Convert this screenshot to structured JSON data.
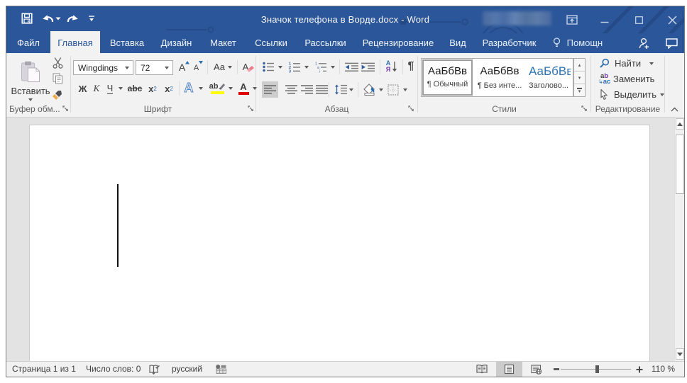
{
  "window": {
    "title": "Значок телефона в Ворде.docx - Word"
  },
  "tabs": [
    {
      "label": "Файл",
      "active": false
    },
    {
      "label": "Главная",
      "active": true
    },
    {
      "label": "Вставка",
      "active": false
    },
    {
      "label": "Дизайн",
      "active": false
    },
    {
      "label": "Макет",
      "active": false
    },
    {
      "label": "Ссылки",
      "active": false
    },
    {
      "label": "Рассылки",
      "active": false
    },
    {
      "label": "Рецензирование",
      "active": false
    },
    {
      "label": "Вид",
      "active": false
    },
    {
      "label": "Разработчик",
      "active": false
    }
  ],
  "tell_me": {
    "label": "Помощн"
  },
  "ribbon": {
    "clipboard": {
      "paste": "Вставить",
      "label": "Буфер обм..."
    },
    "font": {
      "family": "Wingdings",
      "size": "72",
      "bold": "Ж",
      "italic": "К",
      "underline": "Ч",
      "strike": "abc",
      "sub_base": "х",
      "sub_script": "2",
      "sup_base": "х",
      "sup_script": "2",
      "grow": "А",
      "shrink": "А",
      "case": "Aa",
      "clear": "А",
      "effects": "А",
      "highlight": "ab",
      "color": "А",
      "label": "Шрифт"
    },
    "paragraph": {
      "sort_top": "А",
      "sort_bottom": "Я",
      "pilcrow": "¶",
      "label": "Абзац"
    },
    "styles": {
      "items": [
        {
          "preview": "АаБбВв",
          "caption": "¶ Обычный",
          "selected": true
        },
        {
          "preview": "АаБбВв",
          "caption": "¶ Без инте...",
          "selected": false
        },
        {
          "preview": "АаБбВв",
          "caption": "Заголово...",
          "selected": false
        }
      ],
      "label": "Стили"
    },
    "editing": {
      "find": "Найти",
      "replace": "Заменить",
      "select": "Выделить",
      "replace_a": "a",
      "replace_b": "b",
      "replace_ac": "ac",
      "label": "Редактирование"
    }
  },
  "statusbar": {
    "page": "Страница 1 из 1",
    "words": "Число слов: 0",
    "language": "русский",
    "zoom": "110 %"
  },
  "colors": {
    "titlebar_blue": "#2b579a",
    "ribbon_bg": "#f2f2f2",
    "doc_bg": "#e3e3e3",
    "accent_blue": "#2e6fb0",
    "heading_blue": "#2e74b5",
    "highlight_yellow": "#ffff00",
    "font_color_red": "#e00000",
    "selected_gray": "#cdcdcd"
  }
}
